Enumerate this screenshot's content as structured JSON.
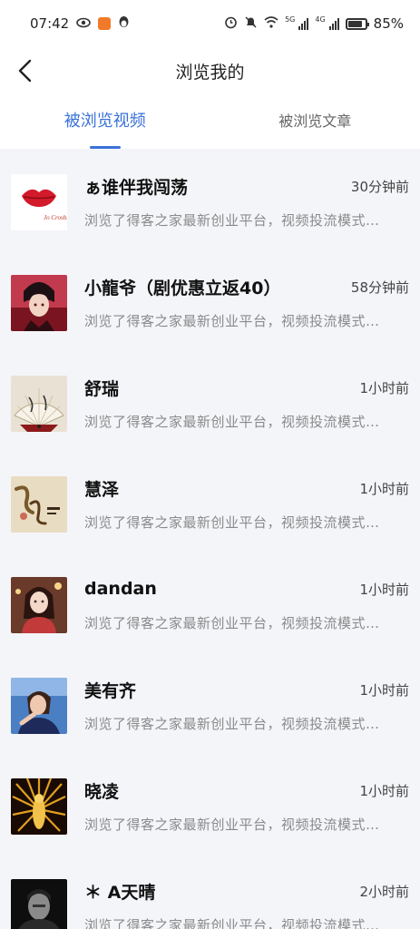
{
  "status_bar": {
    "time": "07:42",
    "network_tag_1": "5G",
    "network_tag_2": "4G",
    "battery_text": "85%",
    "battery_level": 0.85
  },
  "header": {
    "title": "浏览我的",
    "back_icon": "chevron-left-icon"
  },
  "tabs": [
    {
      "label": "被浏览视频",
      "active": true
    },
    {
      "label": "被浏览文章",
      "active": false
    }
  ],
  "colors": {
    "accent": "#3a72d9",
    "background": "#f4f5f9"
  },
  "rows": [
    {
      "name": "ぁ谁伴我闯荡",
      "time": "30分钟前",
      "desc": "浏览了得客之家最新创业平台，视频投流模式…",
      "avatar": "red-lips"
    },
    {
      "name": "小龍爷（剧优惠立返40）",
      "time": "58分钟前",
      "desc": "浏览了得客之家最新创业平台，视频投流模式…",
      "avatar": "anime-boy"
    },
    {
      "name": "舒瑞",
      "time": "1小时前",
      "desc": "浏览了得客之家最新创业平台，视频投流模式…",
      "avatar": "folding-fan"
    },
    {
      "name": "慧泽",
      "time": "1小时前",
      "desc": "浏览了得客之家最新创业平台，视频投流模式…",
      "avatar": "calligraphy"
    },
    {
      "name": "dandan",
      "time": "1小时前",
      "desc": "浏览了得客之家最新创业平台，视频投流模式…",
      "avatar": "girl-photo"
    },
    {
      "name": "美有齐",
      "time": "1小时前",
      "desc": "浏览了得客之家最新创业平台，视频投流模式…",
      "avatar": "woman-blue"
    },
    {
      "name": "晓凌",
      "time": "1小时前",
      "desc": "浏览了得客之家最新创业平台，视频投流模式…",
      "avatar": "golden-buddha"
    },
    {
      "name": "＊ A天晴",
      "time": "2小时前",
      "desc": "浏览了得客之家最新创业平台，视频投流模式…",
      "avatar": "dark-portrait"
    }
  ]
}
